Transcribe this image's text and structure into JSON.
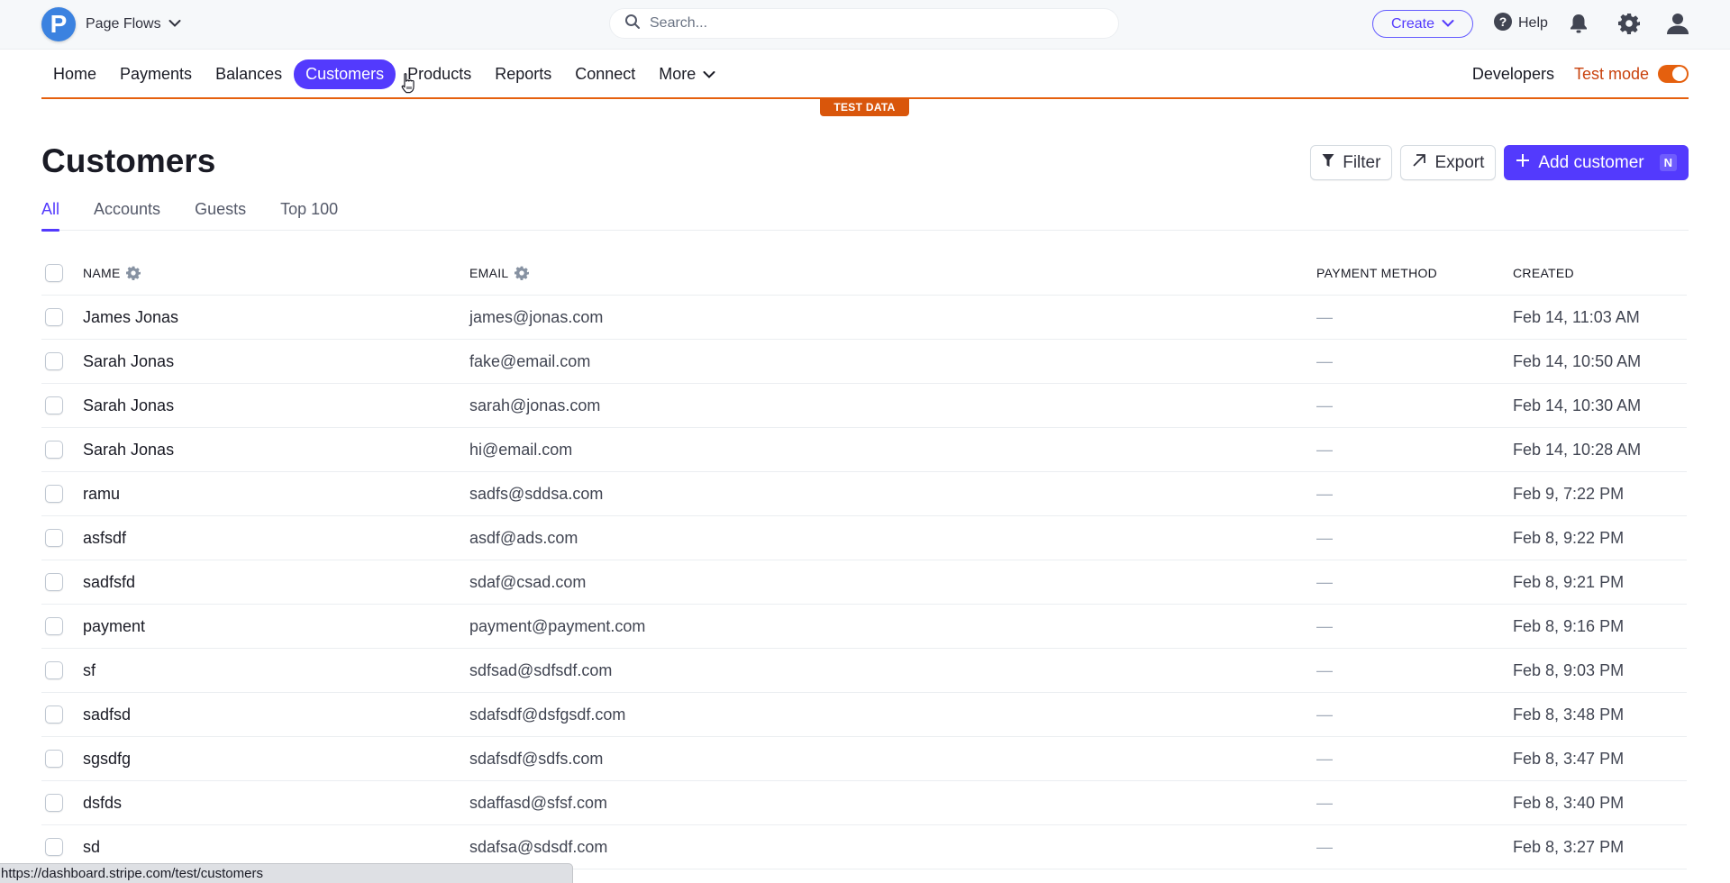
{
  "header": {
    "account_name": "Page Flows",
    "account_initial": "P",
    "search_placeholder": "Search...",
    "create_label": "Create",
    "help_label": "Help"
  },
  "nav": {
    "items": [
      {
        "label": "Home"
      },
      {
        "label": "Payments"
      },
      {
        "label": "Balances"
      },
      {
        "label": "Customers",
        "active": true
      },
      {
        "label": "Products"
      },
      {
        "label": "Reports"
      },
      {
        "label": "Connect"
      },
      {
        "label": "More"
      }
    ],
    "developers_label": "Developers",
    "test_mode_label": "Test mode",
    "test_mode_on": true,
    "test_data_badge": "TEST DATA"
  },
  "page": {
    "title": "Customers",
    "filter_label": "Filter",
    "export_label": "Export",
    "add_label": "Add customer",
    "add_shortcut": "N",
    "tabs": [
      {
        "label": "All",
        "active": true
      },
      {
        "label": "Accounts"
      },
      {
        "label": "Guests"
      },
      {
        "label": "Top 100"
      }
    ]
  },
  "table": {
    "columns": [
      "NAME",
      "EMAIL",
      "PAYMENT METHOD",
      "CREATED"
    ],
    "rows": [
      {
        "name": "James Jonas",
        "email": "james@jonas.com",
        "payment_method": "—",
        "created": "Feb 14, 11:03 AM"
      },
      {
        "name": "Sarah Jonas",
        "email": "fake@email.com",
        "payment_method": "—",
        "created": "Feb 14, 10:50 AM"
      },
      {
        "name": "Sarah Jonas",
        "email": "sarah@jonas.com",
        "payment_method": "—",
        "created": "Feb 14, 10:30 AM"
      },
      {
        "name": "Sarah Jonas",
        "email": "hi@email.com",
        "payment_method": "—",
        "created": "Feb 14, 10:28 AM"
      },
      {
        "name": "ramu",
        "email": "sadfs@sddsa.com",
        "payment_method": "—",
        "created": "Feb 9, 7:22 PM"
      },
      {
        "name": "asfsdf",
        "email": "asdf@ads.com",
        "payment_method": "—",
        "created": "Feb 8, 9:22 PM"
      },
      {
        "name": "sadfsfd",
        "email": "sdaf@csad.com",
        "payment_method": "—",
        "created": "Feb 8, 9:21 PM"
      },
      {
        "name": "payment",
        "email": "payment@payment.com",
        "payment_method": "—",
        "created": "Feb 8, 9:16 PM"
      },
      {
        "name": "sf",
        "email": "sdfsad@sdfsdf.com",
        "payment_method": "—",
        "created": "Feb 8, 9:03 PM"
      },
      {
        "name": "sadfsd",
        "email": "sdafsdf@dsfgsdf.com",
        "payment_method": "—",
        "created": "Feb 8, 3:48 PM"
      },
      {
        "name": "sgsdfg",
        "email": "sdafsdf@sdfs.com",
        "payment_method": "—",
        "created": "Feb 8, 3:47 PM"
      },
      {
        "name": "dsfds",
        "email": "sdaffasd@sfsf.com",
        "payment_method": "—",
        "created": "Feb 8, 3:40 PM"
      },
      {
        "name": "sd",
        "email": "sdafsa@sdsdf.com",
        "payment_method": "—",
        "created": "Feb 8, 3:27 PM"
      }
    ]
  },
  "status_bar": {
    "url": "https://dashboard.stripe.com/test/customers"
  },
  "colors": {
    "accent": "#533afd",
    "test_mode": "#e5600e"
  }
}
